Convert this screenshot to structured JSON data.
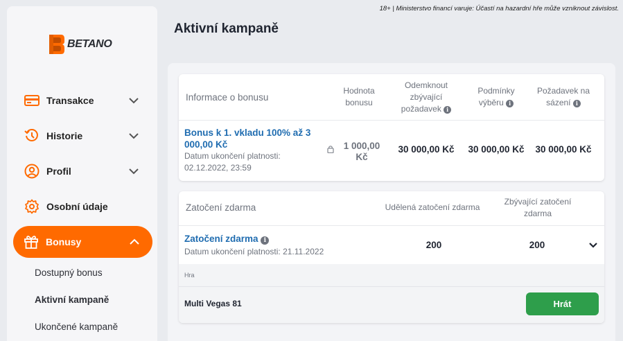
{
  "disclaimer": "18+ | Ministerstvo financí varuje: Účastí na hazardní hře může vzniknout závislost.",
  "brand": {
    "name": "BETANO",
    "color": "#ff6a00"
  },
  "sidebar": {
    "items": [
      {
        "label": "Transakce",
        "icon": "credit-card-icon",
        "expandable": true
      },
      {
        "label": "Historie",
        "icon": "history-icon",
        "expandable": true
      },
      {
        "label": "Profil",
        "icon": "user-icon",
        "expandable": true
      },
      {
        "label": "Osobní údaje",
        "icon": "gear-icon",
        "expandable": false
      },
      {
        "label": "Bonusy",
        "icon": "gift-icon",
        "expandable": true,
        "active": true
      }
    ],
    "subitems": [
      {
        "label": "Dostupný bonus"
      },
      {
        "label": "Aktivní kampaně",
        "current": true
      },
      {
        "label": "Ukončené kampaně"
      }
    ]
  },
  "page": {
    "title": "Aktivní kampaně"
  },
  "bonus_table": {
    "headers": {
      "info": "Informace o bonusu",
      "value": "Hodnota bonusu",
      "unlock": "Odemknout zbývající požadavek",
      "conditions": "Podmínky výběru",
      "wager": "Požadavek na sázení"
    },
    "row": {
      "name": "Bonus k 1. vkladu 100% až 3 000,00 Kč",
      "expiry_label": "Datum ukončení platnosti:",
      "expiry_date": "02.12.2022, 23:59",
      "value": "1 000,00 Kč",
      "unlock": "30 000,00 Kč",
      "conditions": "30 000,00 Kč",
      "wager": "30 000,00 Kč"
    }
  },
  "spins_table": {
    "headers": {
      "title": "Zatočení zdarma",
      "granted": "Udělená zatočení zdarma",
      "remaining": "Zbývající zatočení zdarma"
    },
    "row": {
      "name": "Zatočení zdarma",
      "expiry": "Datum ukončení platnosti: 21.11.2022",
      "granted": "200",
      "remaining": "200"
    },
    "game_label": "Hra",
    "game_name": "Multi Vegas 81",
    "play_label": "Hrát",
    "play_color": "#2e9e4b"
  }
}
